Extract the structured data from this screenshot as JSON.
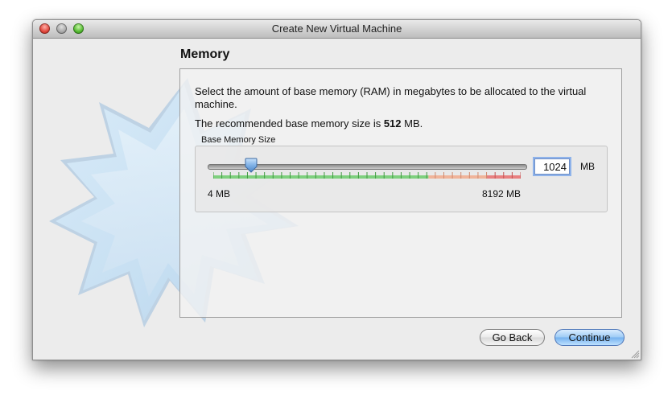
{
  "window": {
    "title": "Create New Virtual Machine",
    "controls": [
      "close",
      "minimize",
      "zoom"
    ]
  },
  "page": {
    "heading": "Memory",
    "description": "Select the amount of base memory (RAM) in megabytes to be allocated to the virtual machine.",
    "recommended_prefix": "The recommended base memory size is",
    "recommended_value": "512",
    "recommended_unit": "MB."
  },
  "memory": {
    "group_label": "Base Memory Size",
    "min_label": "4 MB",
    "max_label": "8192 MB",
    "value": "1024",
    "unit": "MB",
    "slider_min": 4,
    "slider_max": 8192,
    "slider_value": 1024
  },
  "buttons": {
    "back": "Go Back",
    "continue": "Continue"
  },
  "colors": {
    "safe_zone": "#7ed07e",
    "warning_zone": "#f0b49a",
    "danger_zone": "#e88080",
    "accent": "#74b1ee"
  }
}
